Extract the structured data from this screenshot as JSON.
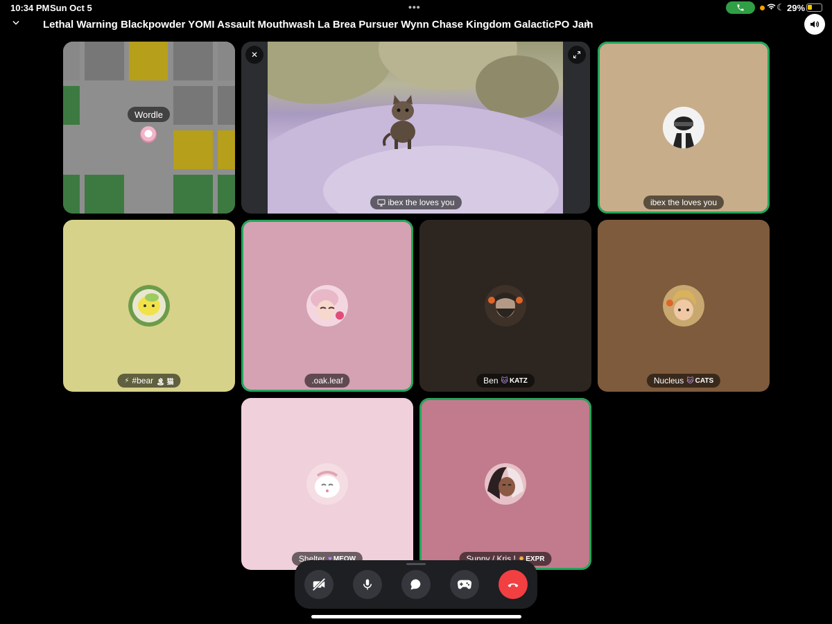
{
  "status_bar": {
    "time": "10:34 PM",
    "date": "Sun Oct 5",
    "battery": "29%",
    "icons": [
      "call-active-icon",
      "wifi-icon",
      "moon-icon",
      "battery-icon"
    ]
  },
  "header": {
    "title": "Lethal Warning Blackpowder YOMI Assault Mouthwash La Brea Pursuer Wynn Chase Kingdom GalacticPO Jam",
    "collapse_icon": "chevron-down-icon",
    "expand_icon": "chevron-right-icon",
    "speaker_icon": "speaker-icon"
  },
  "tiles": [
    {
      "id": "wordle",
      "label": "Wordle",
      "type": "activity",
      "bg": "#8e8e8e"
    },
    {
      "id": "stream",
      "label": "ibex the loves you",
      "type": "screenshare",
      "label_icon": "monitor-icon"
    },
    {
      "id": "ibex",
      "label": "ibex the loves you",
      "bg": "#c8ad8a",
      "speaking": true
    },
    {
      "id": "bear",
      "label": "#bear",
      "prefix": "⚡",
      "suffix": "🏝 猫",
      "bg": "#d6d28a"
    },
    {
      "id": "oakleaf",
      "label": ".oak.leaf",
      "bg": "#d4a2b2",
      "speaking": true
    },
    {
      "id": "ben",
      "label": "Ben",
      "tag": "KATZ",
      "bg": "#2d2620"
    },
    {
      "id": "nucleus",
      "label": "Nucleus",
      "tag": "CATS",
      "bg": "#7e5b3c"
    },
    {
      "id": "shelter",
      "label": "Shelter",
      "tag": "MEOW",
      "bg": "#f0d0da"
    },
    {
      "id": "sunny",
      "label": "Sunny / Kris !",
      "tag": "EXPR",
      "bg": "#c27b8c",
      "speaking": true
    }
  ],
  "controls": [
    {
      "id": "camera",
      "icon": "camera-off-icon"
    },
    {
      "id": "mic",
      "icon": "microphone-icon"
    },
    {
      "id": "chat",
      "icon": "chat-bubble-icon"
    },
    {
      "id": "activities",
      "icon": "gamepad-icon"
    },
    {
      "id": "hangup",
      "icon": "phone-hangup-icon"
    }
  ]
}
